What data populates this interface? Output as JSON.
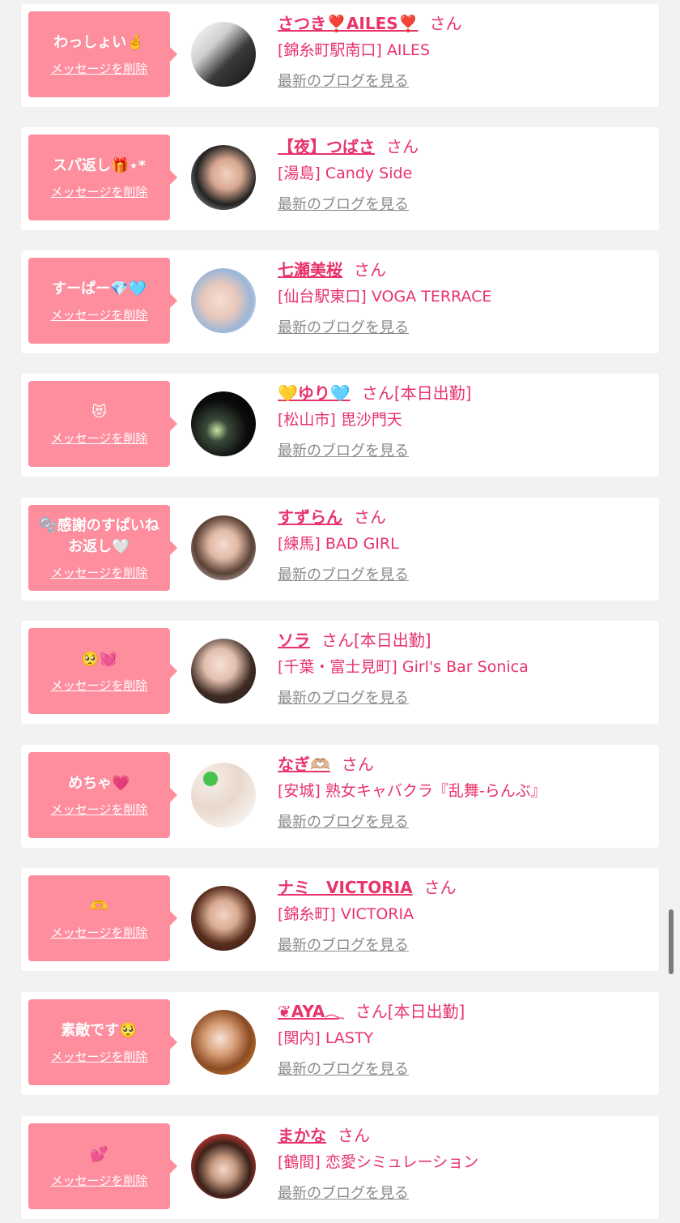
{
  "delete_label": "メッセージを削除",
  "blog_label": "最新のブログを見る",
  "san_label": "さん",
  "colors": {
    "bubble": "#fe8e9e",
    "accent": "#e8336b",
    "link_gray": "#8a8a8a"
  },
  "items": [
    {
      "message": "わっしょい🤞",
      "name": "さつき❣️AILES❣️",
      "status": "",
      "shop": "[錦糸町駅南口] AILES"
    },
    {
      "message": "スパ返し🎁⋆*",
      "name": "【夜】つばさ",
      "status": "",
      "shop": "[湯島] Candy Side"
    },
    {
      "message": "すーぱー💎🩵",
      "name": "七瀬美桜",
      "status": "",
      "shop": "[仙台駅東口] VOGA TERRACE"
    },
    {
      "message": "😻",
      "name": "💛ゆり🩵",
      "status": "[本日出勤]",
      "shop": "[松山市] 毘沙門天"
    },
    {
      "message": "🫧感謝のすぱいね\nお返し🤍",
      "name": "すずらん",
      "status": "",
      "shop": "[練馬] BAD GIRL"
    },
    {
      "message": "🥺💓",
      "name": "ソラ",
      "status": "[本日出勤]",
      "shop": "[千葉・富士見町] Girl's Bar Sonica"
    },
    {
      "message": "めちゃ💗",
      "name": "なぎ🫶🏼",
      "status": "",
      "shop": "[安城] 熟女キャバクラ『乱舞-らんぶ』"
    },
    {
      "message": "🫶",
      "name": "ナミ　VICTORIA",
      "status": "",
      "shop": "[錦糸町] VICTORIA"
    },
    {
      "message": "素敵です🥺",
      "name": "❦AYA𓂃",
      "status": "[本日出勤]",
      "shop": "[関内] LASTY"
    },
    {
      "message": "💕",
      "name": "まかな",
      "status": "",
      "shop": "[鶴間] 恋愛シミュレーション"
    }
  ]
}
